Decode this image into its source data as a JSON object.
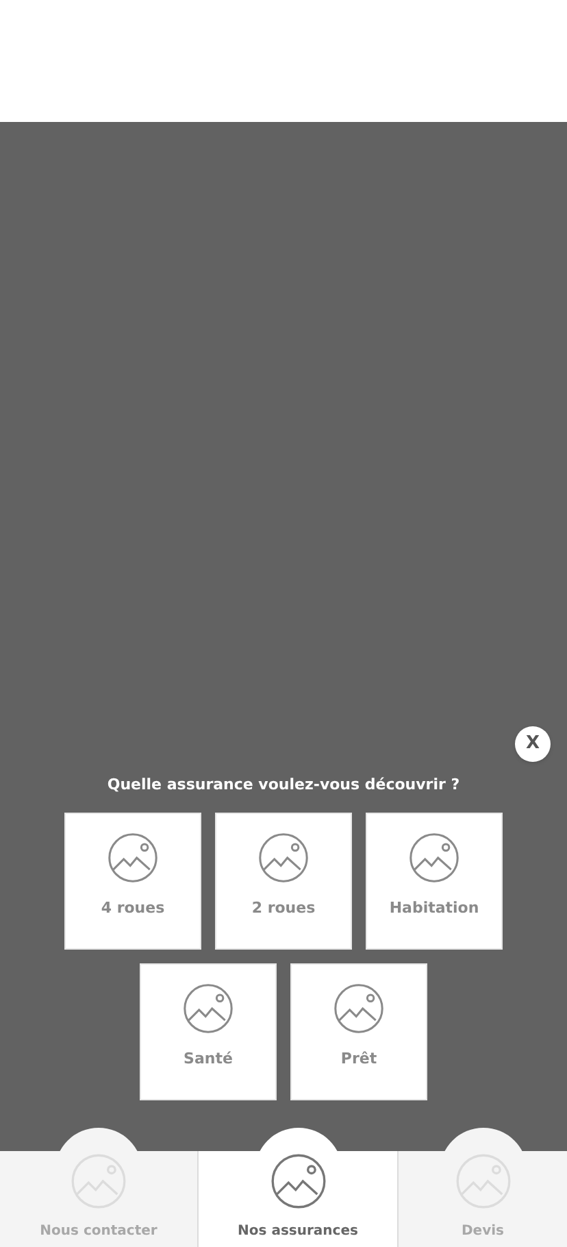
{
  "dialog": {
    "close": "X",
    "title": "Quelle assurance voulez-vous découvrir ?",
    "options": [
      {
        "label": "4 roues"
      },
      {
        "label": "2 roues"
      },
      {
        "label": "Habitation"
      },
      {
        "label": "Santé"
      },
      {
        "label": "Prêt"
      }
    ]
  },
  "tab_bar": [
    {
      "label": "Nous contacter",
      "selected": false
    },
    {
      "label": "Nos assurances",
      "selected": true
    },
    {
      "label": "Devis",
      "selected": false
    }
  ]
}
